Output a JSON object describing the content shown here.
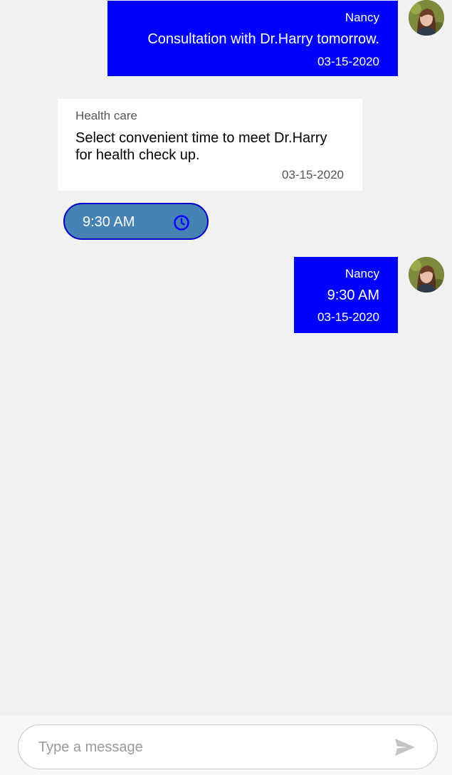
{
  "messages": [
    {
      "direction": "outgoing",
      "sender": "Nancy",
      "text": "Consultation with Dr.Harry tomorrow.",
      "date": "03-15-2020"
    },
    {
      "direction": "incoming",
      "sender": "Health care",
      "text": "Select convenient time to meet Dr.Harry for health check up.",
      "date": "03-15-2020"
    },
    {
      "direction": "outgoing",
      "sender": "Nancy",
      "text": "9:30 AM",
      "date": "03-15-2020"
    }
  ],
  "time_picker": {
    "value": "9:30 AM",
    "icon": "clock-icon"
  },
  "composer": {
    "placeholder": "Type a message",
    "value": "",
    "send_icon": "send-icon"
  },
  "colors": {
    "outgoing_bubble": "#0000ff",
    "incoming_bubble": "#ffffff",
    "time_chip": "#4682b4",
    "time_chip_border": "#0000cd",
    "background": "#f1f1f1"
  }
}
